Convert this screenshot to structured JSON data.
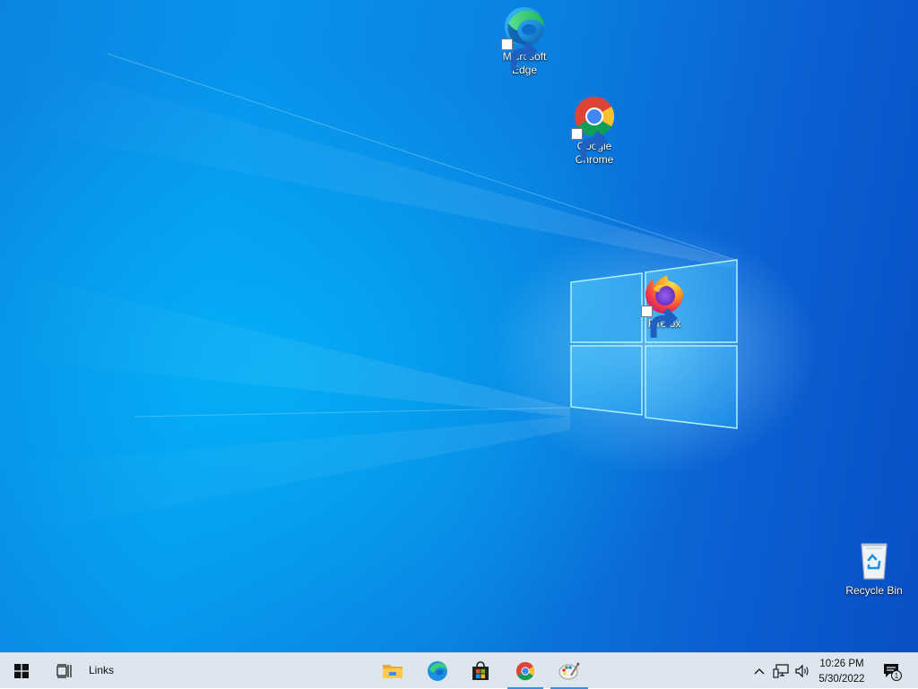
{
  "desktop": {
    "icons": [
      {
        "label": "Microsoft\nEdge",
        "icon": "edge-icon"
      },
      {
        "label": "Google\nChrome",
        "icon": "chrome-icon"
      },
      {
        "label": "Firefox",
        "icon": "firefox-icon"
      },
      {
        "label": "Recycle Bin",
        "icon": "recycle-bin-icon"
      }
    ]
  },
  "taskbar": {
    "start_icon": "windows-logo-icon",
    "task_view_icon": "task-view-icon",
    "links_label": "Links",
    "pinned": [
      {
        "icon": "file-explorer-icon",
        "active": false
      },
      {
        "icon": "edge-icon",
        "active": false
      },
      {
        "icon": "microsoft-store-icon",
        "active": false
      },
      {
        "icon": "chrome-icon",
        "active": true
      },
      {
        "icon": "paint-icon",
        "active": true
      }
    ],
    "tray": {
      "show_hidden_icon": "chevron-up-icon",
      "network_icon": "network-icon",
      "volume_icon": "volume-icon",
      "time": "10:26 PM",
      "date": "5/30/2022",
      "notification_icon": "action-center-icon",
      "notification_count": "1"
    }
  },
  "colors": {
    "wallpaper": "#0a86e0",
    "taskbar": "#dde6ee",
    "active_indicator": "#3a8fe0"
  }
}
